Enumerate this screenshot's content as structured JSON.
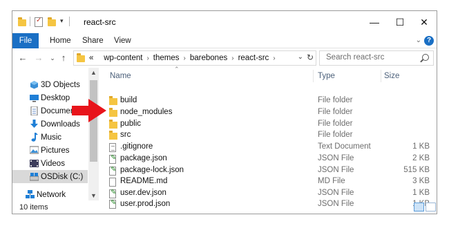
{
  "window": {
    "title": "react-src"
  },
  "ribbon": {
    "tabs": [
      {
        "label": "File"
      },
      {
        "label": "Home"
      },
      {
        "label": "Share"
      },
      {
        "label": "View"
      }
    ]
  },
  "address": {
    "overflow": "«",
    "crumbs": [
      "wp-content",
      "themes",
      "barebones",
      "react-src"
    ]
  },
  "search": {
    "placeholder": "Search react-src"
  },
  "nav_pane": {
    "items": [
      {
        "label": "3D Objects",
        "icon": "3d-objects-icon"
      },
      {
        "label": "Desktop",
        "icon": "desktop-icon"
      },
      {
        "label": "Documents",
        "icon": "documents-icon"
      },
      {
        "label": "Downloads",
        "icon": "downloads-icon"
      },
      {
        "label": "Music",
        "icon": "music-icon"
      },
      {
        "label": "Pictures",
        "icon": "pictures-icon"
      },
      {
        "label": "Videos",
        "icon": "videos-icon"
      },
      {
        "label": "OSDisk (C:)",
        "icon": "drive-icon",
        "selected": true
      },
      {
        "label": "Network",
        "icon": "network-icon"
      }
    ]
  },
  "file_list": {
    "columns": {
      "name": "Name",
      "type": "Type",
      "size": "Size"
    },
    "rows": [
      {
        "name": "build",
        "type": "File folder",
        "size": "",
        "icon": "folder-icon"
      },
      {
        "name": "node_modules",
        "type": "File folder",
        "size": "",
        "icon": "folder-icon"
      },
      {
        "name": "public",
        "type": "File folder",
        "size": "",
        "icon": "folder-icon"
      },
      {
        "name": "src",
        "type": "File folder",
        "size": "",
        "icon": "folder-icon"
      },
      {
        "name": ".gitignore",
        "type": "Text Document",
        "size": "1 KB",
        "icon": "text-file-icon"
      },
      {
        "name": "package.json",
        "type": "JSON File",
        "size": "2 KB",
        "icon": "json-file-icon"
      },
      {
        "name": "package-lock.json",
        "type": "JSON File",
        "size": "515 KB",
        "icon": "json-file-icon"
      },
      {
        "name": "README.md",
        "type": "MD File",
        "size": "3 KB",
        "icon": "file-icon"
      },
      {
        "name": "user.dev.json",
        "type": "JSON File",
        "size": "1 KB",
        "icon": "json-file-icon"
      },
      {
        "name": "user.prod.json",
        "type": "JSON File",
        "size": "1 KB",
        "icon": "json-file-icon"
      }
    ]
  },
  "status": {
    "item_count": "10 items"
  },
  "colors": {
    "accent": "#1a6fc4",
    "annotation_arrow": "#e8141b",
    "folder": "#f5c542"
  }
}
